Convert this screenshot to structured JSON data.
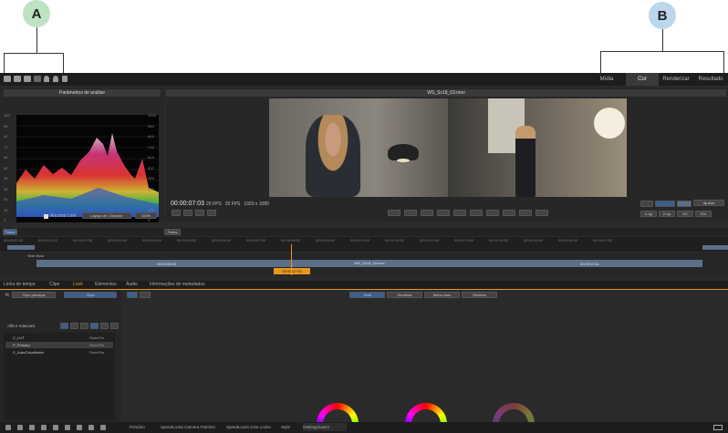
{
  "callouts": {
    "a": "A",
    "b": "B"
  },
  "colors": {
    "callout_a": "#bde3c2",
    "callout_b": "#bcd6ec",
    "accent_orange": "#e8961e",
    "blue_tab": "#3b5f8f"
  },
  "workspace_tabs": [
    "Mídia",
    "Cor",
    "Renderizar",
    "Resultado"
  ],
  "toolbar_icons": [
    "folder-icon",
    "save-icon",
    "export-icon",
    "grid-icon",
    "undo-icon",
    "redo-icon",
    "wrench-icon"
  ],
  "analysis": {
    "title": "Parâmetros de análise",
    "scale_left": [
      "100",
      "90",
      "80",
      "70",
      "60",
      "50",
      "40",
      "30",
      "20",
      "10",
      "0"
    ],
    "scale_right": [
      "1023",
      "920",
      "818",
      "716",
      "614",
      "512",
      "409",
      "307",
      "205",
      "102",
      "0"
    ],
    "anchor_label": "Ancorar Linh",
    "layout_label": "Layout de 1 Monitor",
    "zoom_label": "100%"
  },
  "viewer": {
    "title": "WS_Sc18_03.mov",
    "timecode": "00:00:07:03",
    "fps1": "25 FPS",
    "fps2": "25 FPS",
    "resolution": "1920 x 1080",
    "fit_label": "Ajustar",
    "btn_1up": "1-Up",
    "btn_2up": "2-Up",
    "btn_3": "I/O",
    "btn_4": "Ext"
  },
  "timeline": {
    "tracks_label": "Todos",
    "mark_label": "Todos",
    "track_name": "Sem título",
    "clip_name": "WS_Sc18_03.mov",
    "clip_tc": "00:00:00:00",
    "clip_tc2": "00:00:10:11",
    "clip_tc3": "00:00:07:03",
    "ruler": [
      "00:00:00:00",
      "00:00:01:12",
      "00:00:02:08",
      "00:00:03:04",
      "00:00:04:00",
      "00:00:05:00",
      "00:00:06:00",
      "00:00:07:00",
      "00:00:08:00",
      "00:00:09:00",
      "00:00:10:00",
      "00:00:11:00",
      "00:00:12:00",
      "00:00:13:00",
      "00:00:14:00",
      "00:00:15:00",
      "00:00:16:00",
      "00:00:17:00"
    ]
  },
  "bottom_tabs": [
    "Linha de tempo",
    "Clipe",
    "Look",
    "Elementos",
    "Áudio",
    "Informações de metadados"
  ],
  "layers": {
    "fx_tab": "Clipe principal",
    "fx_tab2": "Clipe",
    "alpha_label": "Alfa e máscara",
    "items": [
      {
        "name": "C_LUT",
        "badge": "RedeFim"
      },
      {
        "name": "P_Primary",
        "badge": "RedeFim"
      },
      {
        "name": "C_AutoColorMatch",
        "badge": "RedeFim"
      }
    ]
  },
  "color_tabs": [
    "Total",
    "Sombras",
    "Meios-tons",
    "Realces"
  ],
  "bottom_bar_tabs": [
    "Primário",
    "SpeedLooks Camera Patches",
    "SpeedLooks Cine Looks",
    "Style",
    "/settings/users"
  ]
}
